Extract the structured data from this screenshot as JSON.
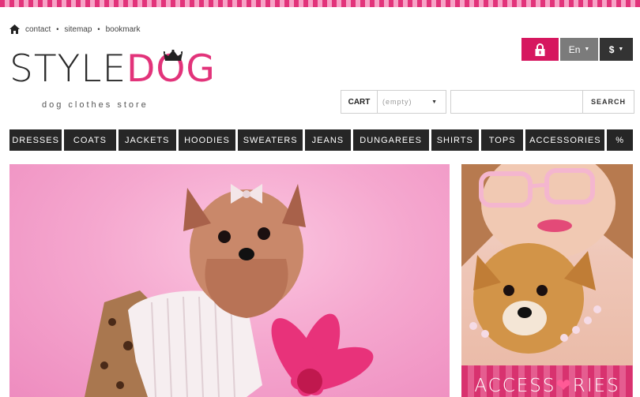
{
  "colors": {
    "accent": "#e2337a",
    "nav_bg": "#262626",
    "lock_bg": "#d6175f"
  },
  "top_links": {
    "icon": "home-icon",
    "items": [
      "contact",
      "sitemap",
      "bookmark"
    ]
  },
  "logo": {
    "part1": "STYLE",
    "part2": "DOG",
    "tagline": "dog clothes store",
    "icon": "crown-icon"
  },
  "header_buttons": {
    "lock_icon": "lock-icon",
    "language": "En",
    "currency": "$"
  },
  "cart": {
    "label": "CART",
    "value": "(empty)"
  },
  "search": {
    "placeholder": "",
    "button": "SEARCH"
  },
  "nav": {
    "items": [
      "DRESSES",
      "COATS",
      "JACKETS",
      "HOODIES",
      "SWEATERS",
      "JEANS",
      "DUNGAREES",
      "SHIRTS",
      "TOPS",
      "ACCESSORIES",
      "%"
    ]
  },
  "banners": {
    "main_alt": "dog in pink sweater",
    "side_text_a": "ACCESS",
    "side_text_b": "RIES"
  }
}
